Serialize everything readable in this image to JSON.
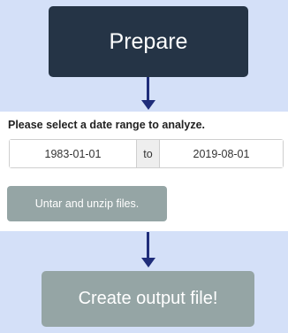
{
  "prepare": {
    "label": "Prepare"
  },
  "date_range": {
    "prompt": "Please select a date range to analyze.",
    "start": "1983-01-01",
    "separator": "to",
    "end": "2019-08-01"
  },
  "untar": {
    "label": "Untar and unzip files."
  },
  "create": {
    "label": "Create output file!"
  },
  "colors": {
    "background": "#d4e0f8",
    "prepare_button": "#253446",
    "secondary_button": "#95a5a5",
    "arrow": "#1f2d7a"
  }
}
